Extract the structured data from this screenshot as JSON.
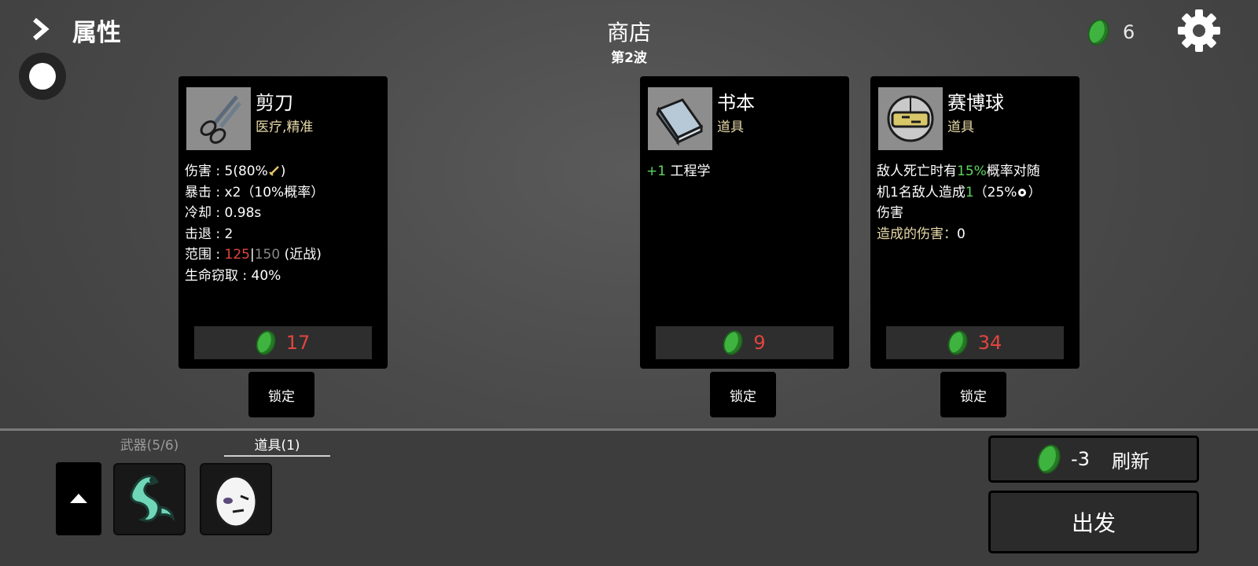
{
  "header": {
    "attributes_label": "属性",
    "shop_title": "商店",
    "wave_label": "第2波",
    "currency_amount": "6"
  },
  "colors": {
    "background": "#4a4a4a",
    "card": "#000000",
    "price_red": "#e0463f",
    "stat_green": "#5fd65f",
    "tag_gold": "#e7d9a8",
    "coin_green": "#3fb33f"
  },
  "cards": [
    {
      "name": "剪刀",
      "tags": "医疗,精准",
      "icon": "scissors-icon",
      "stats": {
        "damage_label": "伤害",
        "damage_value": "5(80%",
        "damage_suffix": ")",
        "crit_label": "暴击",
        "crit_value": "x2（10%概率）",
        "cooldown_label": "冷却",
        "cooldown_value": "0.98s",
        "knockback_label": "击退",
        "knockback_value": "2",
        "range_label": "范围",
        "range_value_current": "125",
        "range_separator": "|",
        "range_value_base": "150",
        "range_type": "(近战)",
        "lifesteal_label": "生命窃取",
        "lifesteal_value": "40%"
      },
      "price": "17",
      "lock_label": "锁定"
    },
    {
      "name": "书本",
      "tags": "道具",
      "icon": "book-icon",
      "effect_bonus": "+1",
      "effect_text": "工程学",
      "price": "9",
      "lock_label": "锁定"
    },
    {
      "name": "赛博球",
      "tags": "道具",
      "icon": "cyberball-icon",
      "effect_line1_a": "敌人死亡时有",
      "effect_line1_b": "15%",
      "effect_line1_c": "概率对随",
      "effect_line2_a": "机",
      "effect_line2_b": "1",
      "effect_line2_c": "名敌人造成",
      "effect_line2_d": "1",
      "effect_line2_e": "（25%",
      "effect_line2_f": "）",
      "effect_line3": "伤害",
      "damage_dealt_label": "造成的伤害：",
      "damage_dealt_value": "0",
      "price": "34",
      "lock_label": "锁定"
    }
  ],
  "inventory": {
    "tab_weapons": "武器(5/6)",
    "tab_items": "道具(1)",
    "slots": [
      "alien-tentacle-icon",
      "egg-face-icon"
    ]
  },
  "actions": {
    "refresh_cost": "-3",
    "refresh_label": "刷新",
    "go_label": "出发"
  }
}
